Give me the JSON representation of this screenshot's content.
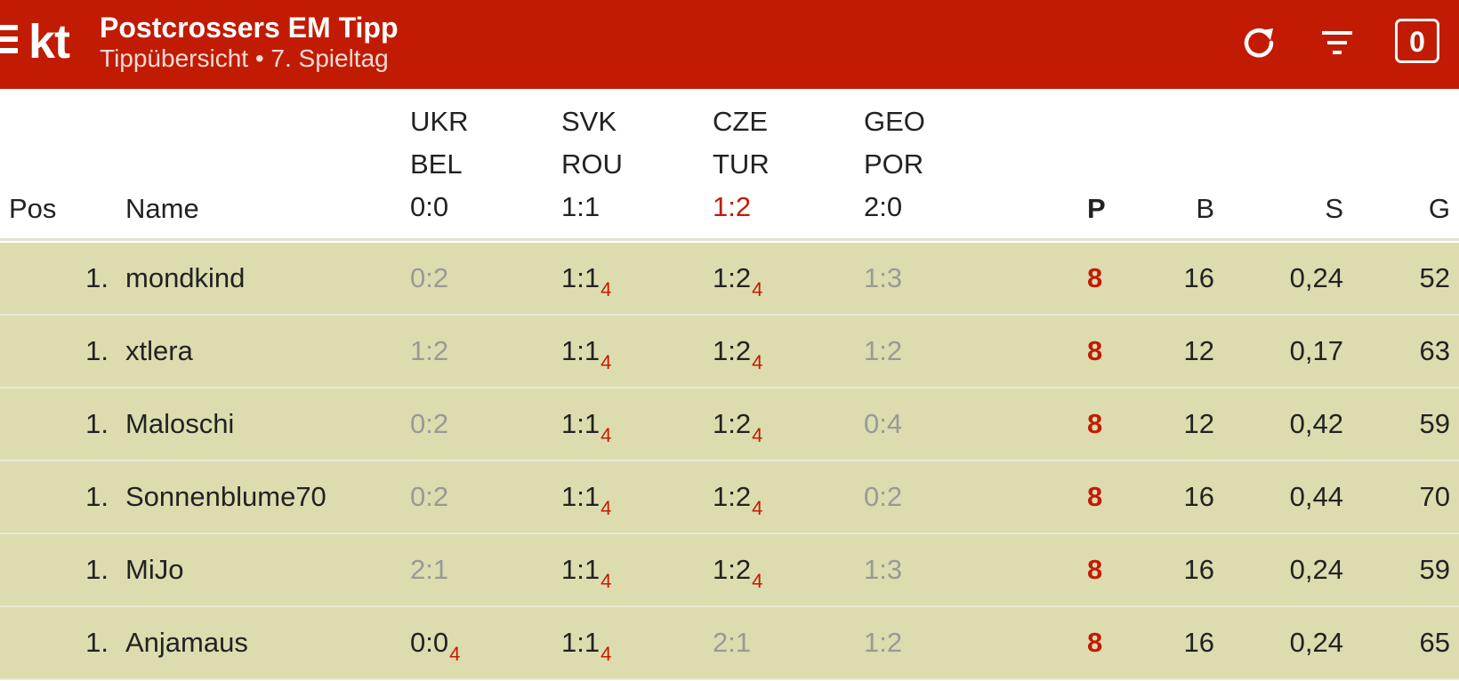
{
  "header": {
    "logo": "kt",
    "title": "Postcrossers EM Tipp",
    "subtitle": "Tippübersicht • 7. Spieltag",
    "badge": "0",
    "icons": [
      "menu-icon",
      "refresh-icon",
      "filter-icon"
    ]
  },
  "columns": {
    "pos": "Pos",
    "name": "Name",
    "p": "P",
    "b": "B",
    "s": "S",
    "g": "G"
  },
  "matches": [
    {
      "home": "UKR",
      "away": "BEL",
      "result": "0:0",
      "live": false
    },
    {
      "home": "SVK",
      "away": "ROU",
      "result": "1:1",
      "live": false
    },
    {
      "home": "CZE",
      "away": "TUR",
      "result": "1:2",
      "live": true
    },
    {
      "home": "GEO",
      "away": "POR",
      "result": "2:0",
      "live": false
    }
  ],
  "rows": [
    {
      "pos": "1.",
      "name": "mondkind",
      "tips": [
        {
          "tip": "0:2",
          "pts": ""
        },
        {
          "tip": "1:1",
          "pts": "4"
        },
        {
          "tip": "1:2",
          "pts": "4"
        },
        {
          "tip": "1:3",
          "pts": ""
        }
      ],
      "p": "8",
      "b": "16",
      "s": "0,24",
      "g": "52"
    },
    {
      "pos": "1.",
      "name": "xtlera",
      "tips": [
        {
          "tip": "1:2",
          "pts": ""
        },
        {
          "tip": "1:1",
          "pts": "4"
        },
        {
          "tip": "1:2",
          "pts": "4"
        },
        {
          "tip": "1:2",
          "pts": ""
        }
      ],
      "p": "8",
      "b": "12",
      "s": "0,17",
      "g": "63"
    },
    {
      "pos": "1.",
      "name": "Maloschi",
      "tips": [
        {
          "tip": "0:2",
          "pts": ""
        },
        {
          "tip": "1:1",
          "pts": "4"
        },
        {
          "tip": "1:2",
          "pts": "4"
        },
        {
          "tip": "0:4",
          "pts": ""
        }
      ],
      "p": "8",
      "b": "12",
      "s": "0,42",
      "g": "59"
    },
    {
      "pos": "1.",
      "name": "Sonnenblume70",
      "tips": [
        {
          "tip": "0:2",
          "pts": ""
        },
        {
          "tip": "1:1",
          "pts": "4"
        },
        {
          "tip": "1:2",
          "pts": "4"
        },
        {
          "tip": "0:2",
          "pts": ""
        }
      ],
      "p": "8",
      "b": "16",
      "s": "0,44",
      "g": "70"
    },
    {
      "pos": "1.",
      "name": "MiJo",
      "tips": [
        {
          "tip": "2:1",
          "pts": ""
        },
        {
          "tip": "1:1",
          "pts": "4"
        },
        {
          "tip": "1:2",
          "pts": "4"
        },
        {
          "tip": "1:3",
          "pts": ""
        }
      ],
      "p": "8",
      "b": "16",
      "s": "0,24",
      "g": "59"
    },
    {
      "pos": "1.",
      "name": "Anjamaus",
      "tips": [
        {
          "tip": "0:0",
          "pts": "4"
        },
        {
          "tip": "1:1",
          "pts": "4"
        },
        {
          "tip": "2:1",
          "pts": ""
        },
        {
          "tip": "1:2",
          "pts": ""
        }
      ],
      "p": "8",
      "b": "16",
      "s": "0,24",
      "g": "65"
    }
  ],
  "colors": {
    "header_bg": "#c21b03",
    "row_bg": "#dddcaf",
    "accent": "#c21b03",
    "muted": "#999999"
  }
}
